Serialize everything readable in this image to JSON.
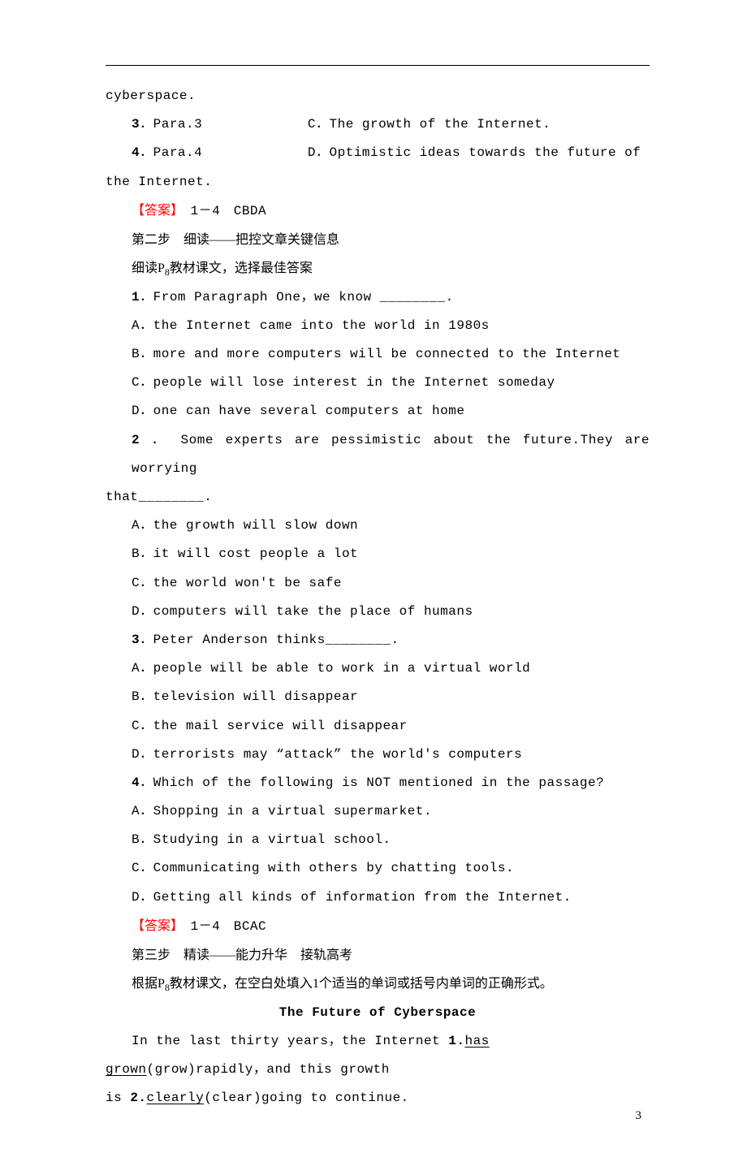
{
  "line0": "cyberspace.",
  "row1_left_num": "3",
  "row1_left": "．Para.3",
  "row1_right": "C．The growth of the Internet.",
  "row2_left_num": "4",
  "row2_left": "．Para.4",
  "row2_right": "D．Optimistic ideas towards the future of",
  "line3": "the Internet.",
  "ans1_label": "【答案】",
  "ans1_text": "　1－4　CBDA",
  "step2": "第二步　细读——把控文章关键信息",
  "step2_instr_a": "细读P",
  "step2_instr_sub": "8",
  "step2_instr_b": "教材课文，选择最佳答案",
  "q1_num": "1",
  "q1": "．From Paragraph One，we know ________.",
  "q1a": "A．the Internet came into the world in 1980s",
  "q1b": "B．more and more computers will be connected to the Internet",
  "q1c": "C．people will lose interest in the Internet someday",
  "q1d": "D．one can have several computers at home",
  "q2_num": "2",
  "q2_line1": " ． Some experts are pessimistic about the future.They are worrying",
  "q2_line2": "that________.",
  "q2a": "A．the growth will slow down",
  "q2b": "B．it will cost people a lot",
  "q2c": "C．the world won't be safe",
  "q2d": "D．computers will take the place of humans",
  "q3_num": "3",
  "q3": "．Peter Anderson thinks________.",
  "q3a": "A．people will be able to work in a virtual world",
  "q3b": "B．television will disappear",
  "q3c": "C．the mail service will disappear",
  "q3d": "D．terrorists may “attack” the world's computers",
  "q4_num": "4",
  "q4": "．Which of the following is NOT mentioned in the passage?",
  "q4a": "A．Shopping in a virtual supermarket.",
  "q4b": "B．Studying in a virtual school.",
  "q4c": "C．Communicating with others by chatting tools.",
  "q4d": "D．Getting all kinds of information from the Internet.",
  "ans2_label": "【答案】",
  "ans2_text": "　1－4　BCAC",
  "step3": "第三步　精读——能力升华　接轨高考",
  "step3_instr_a": "根据P",
  "step3_instr_sub": "8",
  "step3_instr_b": "教材课文，在空白处填入1个适当的单词或括号内单词的正确形式。",
  "title": "The Future of Cyberspace",
  "fill_a": "In the last thirty years，the Internet ",
  "fill_1num": "1.",
  "fill_1u": "has grown",
  "fill_b": "(grow)rapidly，and this growth",
  "fill_c": "is ",
  "fill_2num": "2.",
  "fill_2u": "clearly",
  "fill_d": "(clear)going to continue.",
  "page_number": "3"
}
